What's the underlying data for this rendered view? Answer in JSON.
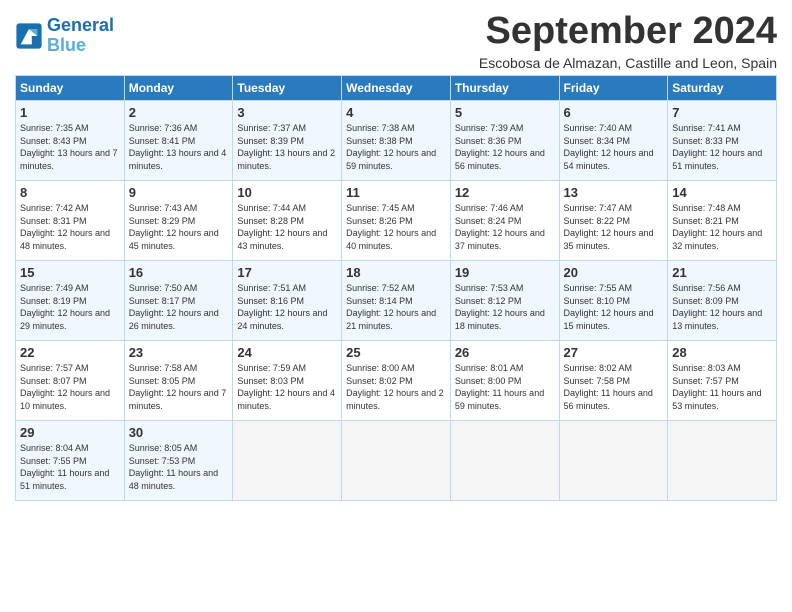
{
  "logo": {
    "line1": "General",
    "line2": "Blue"
  },
  "title": "September 2024",
  "location": "Escobosa de Almazan, Castille and Leon, Spain",
  "days_of_week": [
    "Sunday",
    "Monday",
    "Tuesday",
    "Wednesday",
    "Thursday",
    "Friday",
    "Saturday"
  ],
  "weeks": [
    [
      {
        "day": 1,
        "sunrise": "7:35 AM",
        "sunset": "8:43 PM",
        "daylight": "13 hours and 7 minutes."
      },
      {
        "day": 2,
        "sunrise": "7:36 AM",
        "sunset": "8:41 PM",
        "daylight": "13 hours and 4 minutes."
      },
      {
        "day": 3,
        "sunrise": "7:37 AM",
        "sunset": "8:39 PM",
        "daylight": "13 hours and 2 minutes."
      },
      {
        "day": 4,
        "sunrise": "7:38 AM",
        "sunset": "8:38 PM",
        "daylight": "12 hours and 59 minutes."
      },
      {
        "day": 5,
        "sunrise": "7:39 AM",
        "sunset": "8:36 PM",
        "daylight": "12 hours and 56 minutes."
      },
      {
        "day": 6,
        "sunrise": "7:40 AM",
        "sunset": "8:34 PM",
        "daylight": "12 hours and 54 minutes."
      },
      {
        "day": 7,
        "sunrise": "7:41 AM",
        "sunset": "8:33 PM",
        "daylight": "12 hours and 51 minutes."
      }
    ],
    [
      {
        "day": 8,
        "sunrise": "7:42 AM",
        "sunset": "8:31 PM",
        "daylight": "12 hours and 48 minutes."
      },
      {
        "day": 9,
        "sunrise": "7:43 AM",
        "sunset": "8:29 PM",
        "daylight": "12 hours and 45 minutes."
      },
      {
        "day": 10,
        "sunrise": "7:44 AM",
        "sunset": "8:28 PM",
        "daylight": "12 hours and 43 minutes."
      },
      {
        "day": 11,
        "sunrise": "7:45 AM",
        "sunset": "8:26 PM",
        "daylight": "12 hours and 40 minutes."
      },
      {
        "day": 12,
        "sunrise": "7:46 AM",
        "sunset": "8:24 PM",
        "daylight": "12 hours and 37 minutes."
      },
      {
        "day": 13,
        "sunrise": "7:47 AM",
        "sunset": "8:22 PM",
        "daylight": "12 hours and 35 minutes."
      },
      {
        "day": 14,
        "sunrise": "7:48 AM",
        "sunset": "8:21 PM",
        "daylight": "12 hours and 32 minutes."
      }
    ],
    [
      {
        "day": 15,
        "sunrise": "7:49 AM",
        "sunset": "8:19 PM",
        "daylight": "12 hours and 29 minutes."
      },
      {
        "day": 16,
        "sunrise": "7:50 AM",
        "sunset": "8:17 PM",
        "daylight": "12 hours and 26 minutes."
      },
      {
        "day": 17,
        "sunrise": "7:51 AM",
        "sunset": "8:16 PM",
        "daylight": "12 hours and 24 minutes."
      },
      {
        "day": 18,
        "sunrise": "7:52 AM",
        "sunset": "8:14 PM",
        "daylight": "12 hours and 21 minutes."
      },
      {
        "day": 19,
        "sunrise": "7:53 AM",
        "sunset": "8:12 PM",
        "daylight": "12 hours and 18 minutes."
      },
      {
        "day": 20,
        "sunrise": "7:55 AM",
        "sunset": "8:10 PM",
        "daylight": "12 hours and 15 minutes."
      },
      {
        "day": 21,
        "sunrise": "7:56 AM",
        "sunset": "8:09 PM",
        "daylight": "12 hours and 13 minutes."
      }
    ],
    [
      {
        "day": 22,
        "sunrise": "7:57 AM",
        "sunset": "8:07 PM",
        "daylight": "12 hours and 10 minutes."
      },
      {
        "day": 23,
        "sunrise": "7:58 AM",
        "sunset": "8:05 PM",
        "daylight": "12 hours and 7 minutes."
      },
      {
        "day": 24,
        "sunrise": "7:59 AM",
        "sunset": "8:03 PM",
        "daylight": "12 hours and 4 minutes."
      },
      {
        "day": 25,
        "sunrise": "8:00 AM",
        "sunset": "8:02 PM",
        "daylight": "12 hours and 2 minutes."
      },
      {
        "day": 26,
        "sunrise": "8:01 AM",
        "sunset": "8:00 PM",
        "daylight": "11 hours and 59 minutes."
      },
      {
        "day": 27,
        "sunrise": "8:02 AM",
        "sunset": "7:58 PM",
        "daylight": "11 hours and 56 minutes."
      },
      {
        "day": 28,
        "sunrise": "8:03 AM",
        "sunset": "7:57 PM",
        "daylight": "11 hours and 53 minutes."
      }
    ],
    [
      {
        "day": 29,
        "sunrise": "8:04 AM",
        "sunset": "7:55 PM",
        "daylight": "11 hours and 51 minutes."
      },
      {
        "day": 30,
        "sunrise": "8:05 AM",
        "sunset": "7:53 PM",
        "daylight": "11 hours and 48 minutes."
      },
      null,
      null,
      null,
      null,
      null
    ]
  ]
}
